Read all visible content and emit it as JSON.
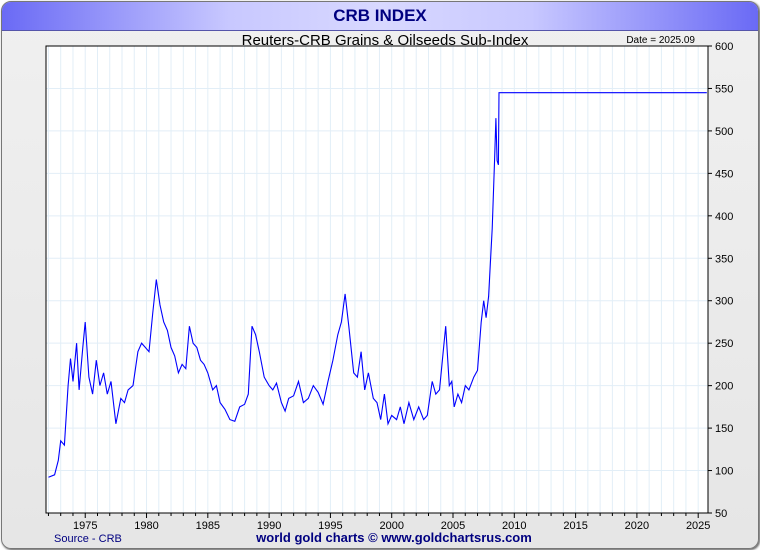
{
  "window": {
    "title": "CRB INDEX"
  },
  "footer": {
    "source": "Source - CRB",
    "credit": "world gold charts © www.goldchartsrus.com"
  },
  "chart_data": {
    "type": "line",
    "title": "Reuters-CRB Grains & Oilseeds Sub-Index",
    "date_label": "Date = 2025.09",
    "xlabel": "",
    "ylabel": "",
    "xlim": [
      1971.8,
      2025.8
    ],
    "ylim": [
      50,
      600
    ],
    "xticks": [
      1975,
      1980,
      1985,
      1990,
      1995,
      2000,
      2005,
      2010,
      2015,
      2020,
      2025
    ],
    "yticks": [
      50,
      100,
      150,
      200,
      250,
      300,
      350,
      400,
      450,
      500,
      550,
      600
    ],
    "grid": true,
    "line_color": "#0000ff",
    "series": [
      {
        "name": "Grains & Oilseeds",
        "points": [
          [
            1972.0,
            92
          ],
          [
            1972.5,
            95
          ],
          [
            1972.8,
            112
          ],
          [
            1973.0,
            135
          ],
          [
            1973.3,
            130
          ],
          [
            1973.6,
            200
          ],
          [
            1973.8,
            232
          ],
          [
            1974.0,
            205
          ],
          [
            1974.3,
            250
          ],
          [
            1974.5,
            195
          ],
          [
            1974.8,
            245
          ],
          [
            1975.0,
            275
          ],
          [
            1975.3,
            210
          ],
          [
            1975.6,
            190
          ],
          [
            1975.9,
            230
          ],
          [
            1976.2,
            200
          ],
          [
            1976.5,
            215
          ],
          [
            1976.8,
            190
          ],
          [
            1977.1,
            205
          ],
          [
            1977.5,
            155
          ],
          [
            1977.9,
            185
          ],
          [
            1978.2,
            180
          ],
          [
            1978.5,
            195
          ],
          [
            1978.9,
            200
          ],
          [
            1979.3,
            240
          ],
          [
            1979.6,
            250
          ],
          [
            1979.9,
            245
          ],
          [
            1980.2,
            240
          ],
          [
            1980.5,
            285
          ],
          [
            1980.8,
            325
          ],
          [
            1981.1,
            295
          ],
          [
            1981.4,
            275
          ],
          [
            1981.7,
            265
          ],
          [
            1982.0,
            245
          ],
          [
            1982.3,
            235
          ],
          [
            1982.6,
            215
          ],
          [
            1982.9,
            225
          ],
          [
            1983.2,
            220
          ],
          [
            1983.5,
            270
          ],
          [
            1983.8,
            250
          ],
          [
            1984.1,
            245
          ],
          [
            1984.4,
            230
          ],
          [
            1984.7,
            225
          ],
          [
            1985.0,
            215
          ],
          [
            1985.4,
            195
          ],
          [
            1985.7,
            200
          ],
          [
            1986.0,
            180
          ],
          [
            1986.4,
            172
          ],
          [
            1986.8,
            160
          ],
          [
            1987.2,
            158
          ],
          [
            1987.6,
            175
          ],
          [
            1988.0,
            178
          ],
          [
            1988.3,
            190
          ],
          [
            1988.6,
            270
          ],
          [
            1988.9,
            260
          ],
          [
            1989.2,
            240
          ],
          [
            1989.6,
            210
          ],
          [
            1990.0,
            200
          ],
          [
            1990.3,
            195
          ],
          [
            1990.6,
            203
          ],
          [
            1991.0,
            180
          ],
          [
            1991.3,
            170
          ],
          [
            1991.6,
            185
          ],
          [
            1992.0,
            188
          ],
          [
            1992.4,
            205
          ],
          [
            1992.8,
            180
          ],
          [
            1993.2,
            185
          ],
          [
            1993.6,
            200
          ],
          [
            1994.0,
            192
          ],
          [
            1994.4,
            178
          ],
          [
            1994.8,
            205
          ],
          [
            1995.2,
            230
          ],
          [
            1995.6,
            260
          ],
          [
            1995.9,
            275
          ],
          [
            1996.2,
            308
          ],
          [
            1996.5,
            270
          ],
          [
            1996.9,
            215
          ],
          [
            1997.2,
            210
          ],
          [
            1997.5,
            240
          ],
          [
            1997.8,
            195
          ],
          [
            1998.1,
            215
          ],
          [
            1998.5,
            185
          ],
          [
            1998.8,
            180
          ],
          [
            1999.1,
            160
          ],
          [
            1999.4,
            190
          ],
          [
            1999.7,
            155
          ],
          [
            2000.0,
            165
          ],
          [
            2000.4,
            160
          ],
          [
            2000.7,
            175
          ],
          [
            2001.0,
            155
          ],
          [
            2001.4,
            180
          ],
          [
            2001.8,
            160
          ],
          [
            2002.2,
            175
          ],
          [
            2002.6,
            160
          ],
          [
            2002.9,
            165
          ],
          [
            2003.3,
            205
          ],
          [
            2003.6,
            190
          ],
          [
            2003.9,
            195
          ],
          [
            2004.2,
            240
          ],
          [
            2004.4,
            270
          ],
          [
            2004.7,
            200
          ],
          [
            2004.9,
            205
          ],
          [
            2005.1,
            175
          ],
          [
            2005.4,
            190
          ],
          [
            2005.7,
            180
          ],
          [
            2006.0,
            200
          ],
          [
            2006.3,
            195
          ],
          [
            2006.7,
            210
          ],
          [
            2007.0,
            218
          ],
          [
            2007.3,
            275
          ],
          [
            2007.5,
            300
          ],
          [
            2007.7,
            280
          ],
          [
            2007.9,
            305
          ],
          [
            2008.2,
            385
          ],
          [
            2008.4,
            470
          ],
          [
            2008.5,
            515
          ],
          [
            2008.6,
            465
          ],
          [
            2008.7,
            460
          ],
          [
            2008.75,
            545
          ],
          [
            2025.7,
            545
          ]
        ]
      }
    ]
  }
}
